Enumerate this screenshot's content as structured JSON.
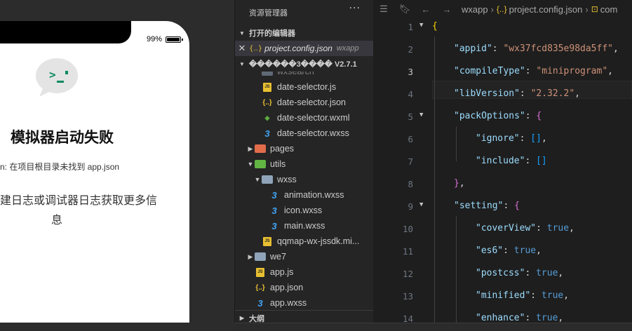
{
  "simulator": {
    "battery": "99%",
    "title": "模拟器启动失败",
    "error": "n: 在项目根目录未找到 app.json",
    "hint_line1": "建日志或调试器日志获取更多信",
    "hint_line2": "息",
    "icon": "chat-bubble-terminal-icon"
  },
  "explorer": {
    "title": "资源管理器",
    "more": "···",
    "open_editors_label": "打开的编辑器",
    "open_file": {
      "name": "project.config.json",
      "dir": "wxapp"
    },
    "project_label": "������3���� V2.7.1",
    "outline_label": "大纲",
    "tree": [
      {
        "label": "wxsearch",
        "type": "folder",
        "depth": 2,
        "partial": true
      },
      {
        "label": "date-selector.js",
        "type": "js",
        "depth": 2
      },
      {
        "label": "date-selector.json",
        "type": "json",
        "depth": 2
      },
      {
        "label": "date-selector.wxml",
        "type": "wxml",
        "depth": 2
      },
      {
        "label": "date-selector.wxss",
        "type": "css",
        "depth": 2
      },
      {
        "label": "pages",
        "type": "folder",
        "depth": 1,
        "expanded": false,
        "color": "#e06c4a"
      },
      {
        "label": "utils",
        "type": "folder",
        "depth": 1,
        "expanded": true,
        "color": "#62b543"
      },
      {
        "label": "wxss",
        "type": "folder",
        "depth": 2,
        "expanded": true,
        "color": "#8fa4b8"
      },
      {
        "label": "animation.wxss",
        "type": "css",
        "depth": 3
      },
      {
        "label": "icon.wxss",
        "type": "css",
        "depth": 3
      },
      {
        "label": "main.wxss",
        "type": "css",
        "depth": 3
      },
      {
        "label": "qqmap-wx-jssdk.mi...",
        "type": "js",
        "depth": 2
      },
      {
        "label": "we7",
        "type": "folder",
        "depth": 1,
        "expanded": false,
        "color": "#8fa4b8"
      },
      {
        "label": "app.js",
        "type": "js",
        "depth": 1
      },
      {
        "label": "app.json",
        "type": "json",
        "depth": 1
      },
      {
        "label": "app.wxss",
        "type": "css",
        "depth": 1
      }
    ]
  },
  "editor": {
    "breadcrumb": [
      "wxapp",
      "project.config.json",
      "com"
    ],
    "toolbar_icons": [
      "list-icon",
      "bookmark-icon",
      "back-arrow-icon",
      "forward-arrow-icon"
    ],
    "current_line": 3,
    "lines": [
      {
        "n": "1",
        "parts": [
          [
            "br1",
            "{"
          ]
        ],
        "indent": 0,
        "fold": true
      },
      {
        "n": "2",
        "parts": [
          [
            "k",
            "\"appid\""
          ],
          [
            "p",
            ": "
          ],
          [
            "s",
            "\"wx37fcd835e98da5ff\""
          ],
          [
            "p",
            ","
          ]
        ],
        "indent": 1
      },
      {
        "n": "3",
        "parts": [
          [
            "k",
            "\"compileType\""
          ],
          [
            "p",
            ": "
          ],
          [
            "s",
            "\"miniprogram\""
          ],
          [
            "p",
            ","
          ]
        ],
        "indent": 1
      },
      {
        "n": "4",
        "parts": [
          [
            "k",
            "\"libVersion\""
          ],
          [
            "p",
            ": "
          ],
          [
            "s",
            "\"2.32.2\""
          ],
          [
            "p",
            ","
          ]
        ],
        "indent": 1
      },
      {
        "n": "5",
        "parts": [
          [
            "k",
            "\"packOptions\""
          ],
          [
            "p",
            ": "
          ],
          [
            "br2",
            "{"
          ]
        ],
        "indent": 1,
        "fold": true
      },
      {
        "n": "6",
        "parts": [
          [
            "k",
            "\"ignore\""
          ],
          [
            "p",
            ": "
          ],
          [
            "br3",
            "[]"
          ],
          [
            "p",
            ","
          ]
        ],
        "indent": 2
      },
      {
        "n": "7",
        "parts": [
          [
            "k",
            "\"include\""
          ],
          [
            "p",
            ": "
          ],
          [
            "br3",
            "[]"
          ]
        ],
        "indent": 2
      },
      {
        "n": "8",
        "parts": [
          [
            "br2",
            "}"
          ],
          [
            "p",
            ","
          ]
        ],
        "indent": 1
      },
      {
        "n": "9",
        "parts": [
          [
            "k",
            "\"setting\""
          ],
          [
            "p",
            ": "
          ],
          [
            "br2",
            "{"
          ]
        ],
        "indent": 1,
        "fold": true
      },
      {
        "n": "10",
        "parts": [
          [
            "k",
            "\"coverView\""
          ],
          [
            "p",
            ": "
          ],
          [
            "b",
            "true"
          ],
          [
            "p",
            ","
          ]
        ],
        "indent": 2
      },
      {
        "n": "11",
        "parts": [
          [
            "k",
            "\"es6\""
          ],
          [
            "p",
            ": "
          ],
          [
            "b",
            "true"
          ],
          [
            "p",
            ","
          ]
        ],
        "indent": 2
      },
      {
        "n": "12",
        "parts": [
          [
            "k",
            "\"postcss\""
          ],
          [
            "p",
            ": "
          ],
          [
            "b",
            "true"
          ],
          [
            "p",
            ","
          ]
        ],
        "indent": 2
      },
      {
        "n": "13",
        "parts": [
          [
            "k",
            "\"minified\""
          ],
          [
            "p",
            ": "
          ],
          [
            "b",
            "true"
          ],
          [
            "p",
            ","
          ]
        ],
        "indent": 2
      },
      {
        "n": "14",
        "parts": [
          [
            "k",
            "\"enhance\""
          ],
          [
            "p",
            ": "
          ],
          [
            "b",
            "true"
          ],
          [
            "p",
            ","
          ]
        ],
        "indent": 2
      }
    ]
  },
  "colors": {
    "accent": "#569cd6",
    "string": "#ce9178",
    "key": "#9cdcfe",
    "js_icon": "#e8c031",
    "css_icon": "#42a5f5"
  }
}
